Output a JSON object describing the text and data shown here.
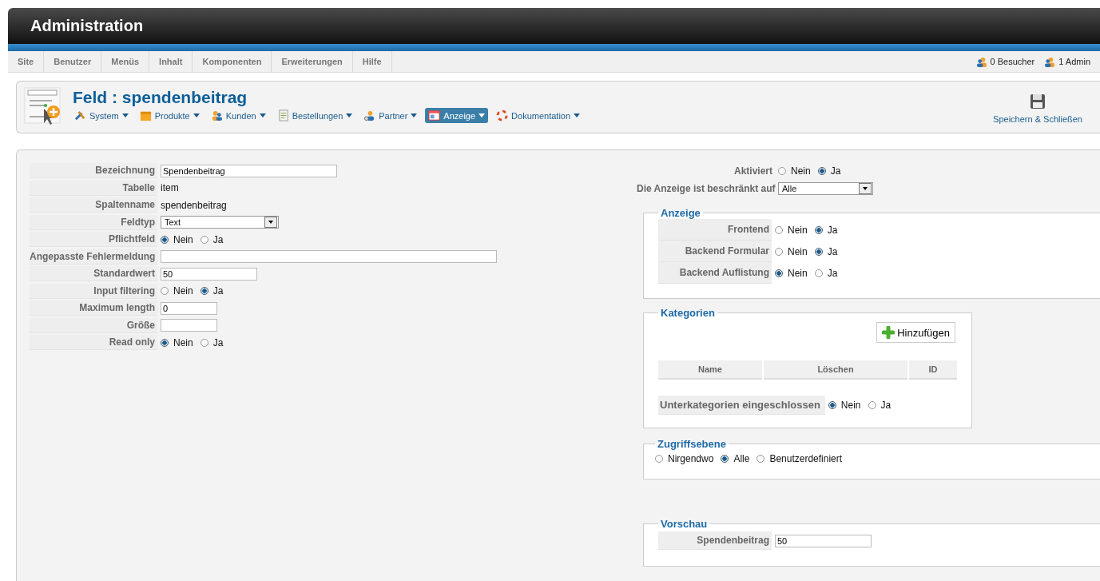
{
  "header": {
    "title": "Administration"
  },
  "menu": [
    {
      "label": "Site"
    },
    {
      "label": "Benutzer"
    },
    {
      "label": "Menüs"
    },
    {
      "label": "Inhalt"
    },
    {
      "label": "Komponenten"
    },
    {
      "label": "Erweiterungen"
    },
    {
      "label": "Hilfe"
    }
  ],
  "status": [
    {
      "label": "0 Besucher"
    },
    {
      "label": "1 Admin"
    }
  ],
  "toolbar": {
    "title": "Feld : spendenbeitrag",
    "submenu": [
      {
        "label": "System",
        "kind": "tools",
        "selected": false
      },
      {
        "label": "Produkte",
        "kind": "box",
        "selected": false
      },
      {
        "label": "Kunden",
        "kind": "people",
        "selected": false
      },
      {
        "label": "Bestellungen",
        "kind": "document",
        "selected": false
      },
      {
        "label": "Partner",
        "kind": "partner",
        "selected": false
      },
      {
        "label": "Anzeige",
        "kind": "display",
        "selected": true
      },
      {
        "label": "Dokumentation",
        "kind": "lifebuoy",
        "selected": false
      }
    ],
    "save_button": "Speichern & Schließen"
  },
  "fields": [
    {
      "label": "Bezeichnung",
      "kind": "input",
      "value": "Spendenbeitrag"
    },
    {
      "label": "Tabelle",
      "kind": "text",
      "value": "item"
    },
    {
      "label": "Spaltenname",
      "kind": "text",
      "value": "spendenbeitrag"
    },
    {
      "label": "Feldtyp",
      "kind": "select",
      "value": "Text"
    },
    {
      "label": "Pflichtfeld",
      "kind": "radio",
      "options": [
        {
          "label": "Nein",
          "selected": true
        },
        {
          "label": "Ja",
          "selected": false
        }
      ]
    },
    {
      "label": "Angepasste Fehlermeldung",
      "kind": "wide"
    },
    {
      "label": "Standardwert",
      "kind": "medium",
      "value": "50"
    },
    {
      "label": "Input filtering",
      "kind": "radio",
      "options": [
        {
          "label": "Nein",
          "selected": false
        },
        {
          "label": "Ja",
          "selected": true
        }
      ]
    },
    {
      "label": "Maximum length",
      "kind": "short",
      "value": "0"
    },
    {
      "label": "Größe",
      "kind": "short"
    },
    {
      "label": "Read only",
      "kind": "radio",
      "options": [
        {
          "label": "Nein",
          "selected": true
        },
        {
          "label": "Ja",
          "selected": false
        }
      ]
    }
  ],
  "aktiviert": {
    "label": "Aktiviert",
    "options": [
      {
        "label": "Nein",
        "selected": false
      },
      {
        "label": "Ja",
        "selected": true
      }
    ]
  },
  "restriction": {
    "label": "Die Anzeige ist beschränkt auf",
    "value": "Alle"
  },
  "anzeige": {
    "legend": "Anzeige",
    "rows": [
      {
        "label": "Frontend",
        "options": [
          {
            "label": "Nein",
            "selected": false
          },
          {
            "label": "Ja",
            "selected": true
          }
        ]
      },
      {
        "label": "Backend Formular",
        "options": [
          {
            "label": "Nein",
            "selected": false
          },
          {
            "label": "Ja",
            "selected": true
          }
        ]
      },
      {
        "label": "Backend Auflistung",
        "options": [
          {
            "label": "Nein",
            "selected": true
          },
          {
            "label": "Ja",
            "selected": false
          }
        ]
      }
    ]
  },
  "kategorien": {
    "legend": "Kategorien",
    "add_button": "Hinzufügen",
    "columns": [
      "Name",
      "Löschen",
      "ID"
    ],
    "subcategories": {
      "label": "Unterkategorien eingeschlossen",
      "options": [
        {
          "label": "Nein",
          "selected": true
        },
        {
          "label": "Ja",
          "selected": false
        }
      ]
    }
  },
  "zugriffsebene": {
    "legend": "Zugriffsebene",
    "options": [
      {
        "label": "Nirgendwo",
        "selected": false
      },
      {
        "label": "Alle",
        "selected": true
      },
      {
        "label": "Benutzerdefiniert",
        "selected": false
      }
    ]
  },
  "vorschau": {
    "legend": "Vorschau",
    "label": "Spendenbeitrag",
    "value": "50"
  }
}
